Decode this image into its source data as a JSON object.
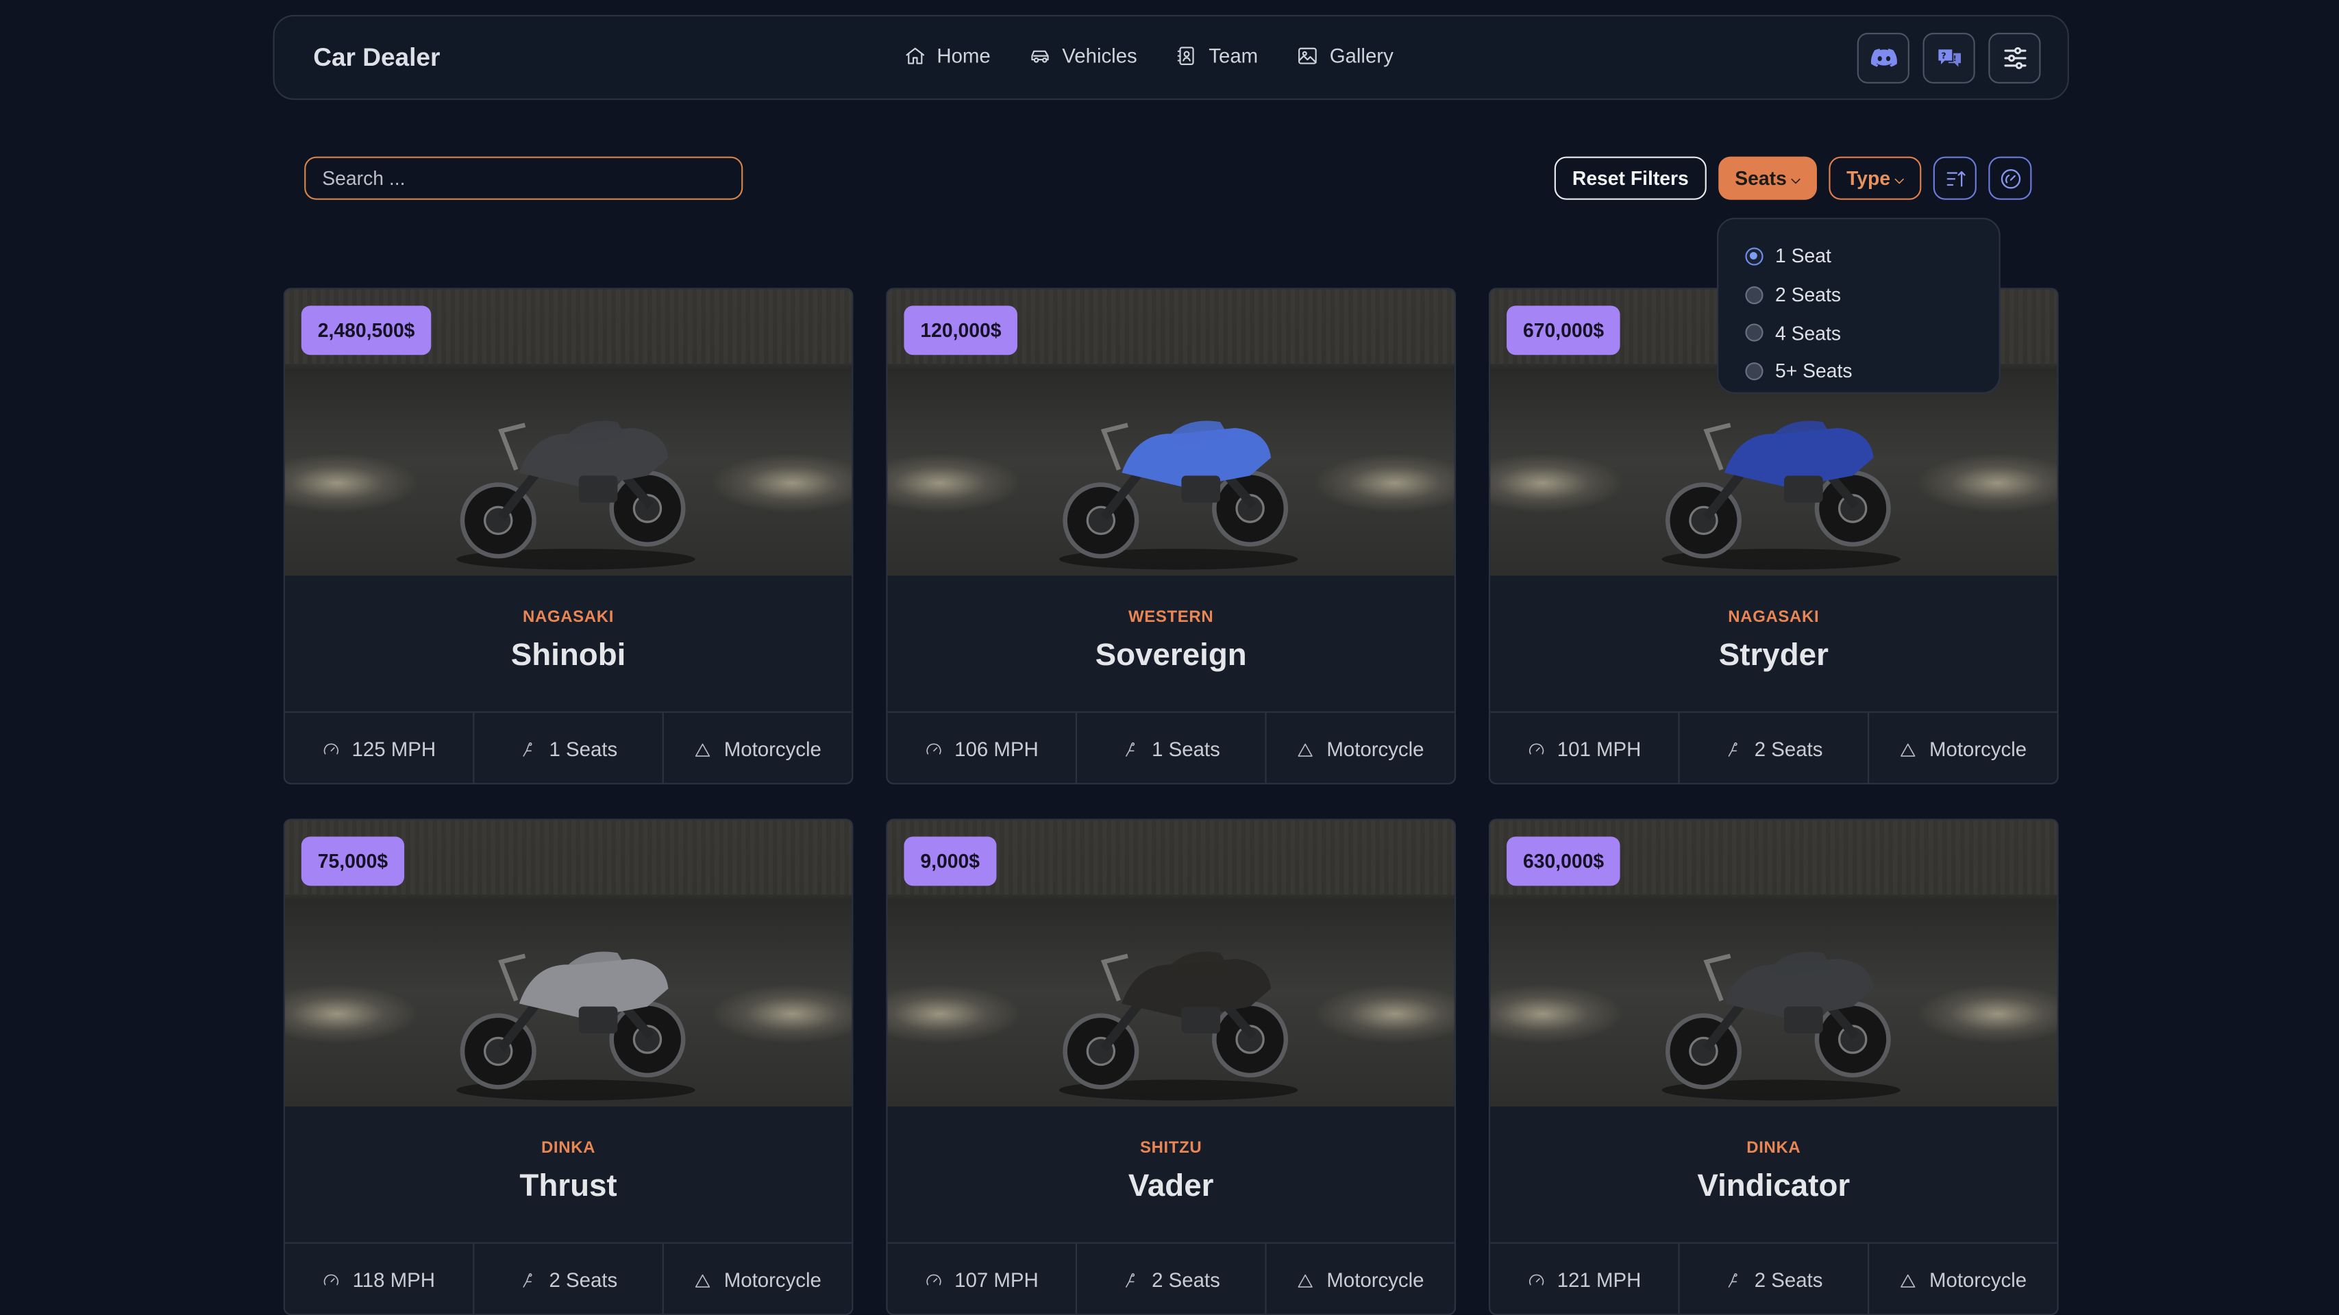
{
  "app": {
    "title": "Car Dealer"
  },
  "nav": {
    "links": [
      {
        "label": "Home",
        "icon": "home-icon"
      },
      {
        "label": "Vehicles",
        "icon": "car-icon"
      },
      {
        "label": "Team",
        "icon": "team-icon"
      },
      {
        "label": "Gallery",
        "icon": "gallery-icon"
      }
    ],
    "actions": [
      {
        "icon": "discord-icon"
      },
      {
        "icon": "chat-icon"
      },
      {
        "icon": "sliders-icon"
      }
    ]
  },
  "toolbar": {
    "search_placeholder": "Search ...",
    "search_value": "",
    "reset_label": "Reset Filters",
    "seats_label": "Seats",
    "type_label": "Type",
    "sort_icon": "sort-icon",
    "speed_icon": "speedometer-icon"
  },
  "seats_dropdown": {
    "options": [
      "1 Seat",
      "2 Seats",
      "4 Seats",
      "5+ Seats"
    ],
    "selected": "1 Seat"
  },
  "colors": {
    "accent": "#e17e4e",
    "price_badge": "#a584f5",
    "background": "#0d1320",
    "brand_label": "#ea8654"
  },
  "vehicles": [
    {
      "price": "2,480,500$",
      "brand": "NAGASAKI",
      "model": "Shinobi",
      "speed": "125 MPH",
      "seats": "1 Seats",
      "type": "Motorcycle"
    },
    {
      "price": "120,000$",
      "brand": "WESTERN",
      "model": "Sovereign",
      "speed": "106 MPH",
      "seats": "1 Seats",
      "type": "Motorcycle"
    },
    {
      "price": "670,000$",
      "brand": "NAGASAKI",
      "model": "Stryder",
      "speed": "101 MPH",
      "seats": "2 Seats",
      "type": "Motorcycle"
    },
    {
      "price": "75,000$",
      "brand": "DINKA",
      "model": "Thrust",
      "speed": "118 MPH",
      "seats": "2 Seats",
      "type": "Motorcycle"
    },
    {
      "price": "9,000$",
      "brand": "SHITZU",
      "model": "Vader",
      "speed": "107 MPH",
      "seats": "2 Seats",
      "type": "Motorcycle"
    },
    {
      "price": "630,000$",
      "brand": "DINKA",
      "model": "Vindicator",
      "speed": "121 MPH",
      "seats": "2 Seats",
      "type": "Motorcycle"
    }
  ]
}
